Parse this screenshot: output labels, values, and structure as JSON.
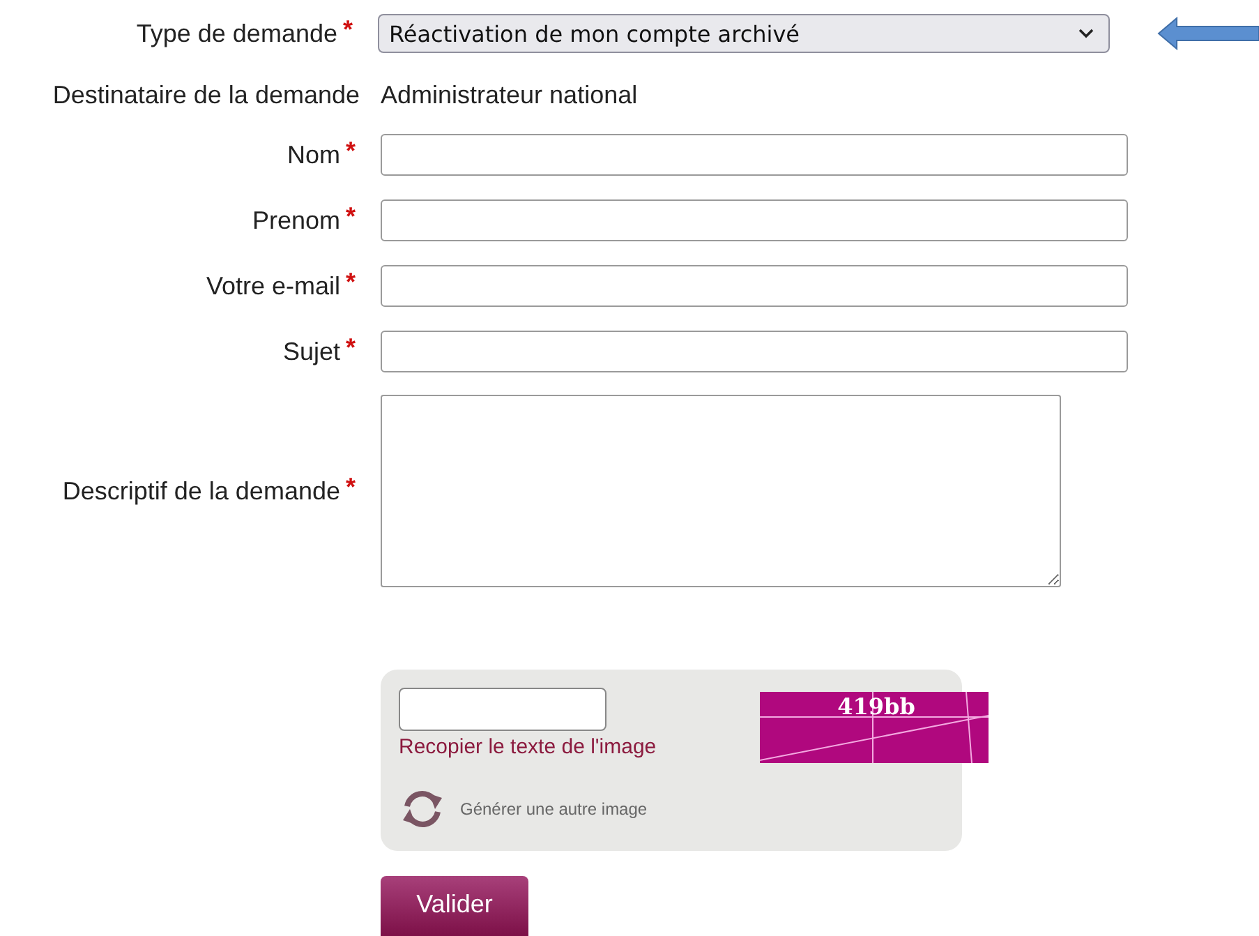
{
  "fields": [
    {
      "kind": "select",
      "label": "Type de demande",
      "required": true,
      "value": "Réactivation de mon compte archivé"
    },
    {
      "kind": "static",
      "label": "Destinataire de la demande",
      "required": false,
      "value": "Administrateur national"
    },
    {
      "kind": "text",
      "label": "Nom",
      "required": true
    },
    {
      "kind": "text",
      "label": "Prenom",
      "required": true
    },
    {
      "kind": "text",
      "label": "Votre e-mail",
      "required": true
    },
    {
      "kind": "text",
      "label": "Sujet",
      "required": true
    },
    {
      "kind": "textarea",
      "label": "Descriptif de la demande",
      "required": true
    }
  ],
  "required_mark": "*",
  "captcha": {
    "input_label": "Recopier le texte de l'image",
    "code": "419bb",
    "refresh_label": "Générer une autre image"
  },
  "submit": "Valider"
}
